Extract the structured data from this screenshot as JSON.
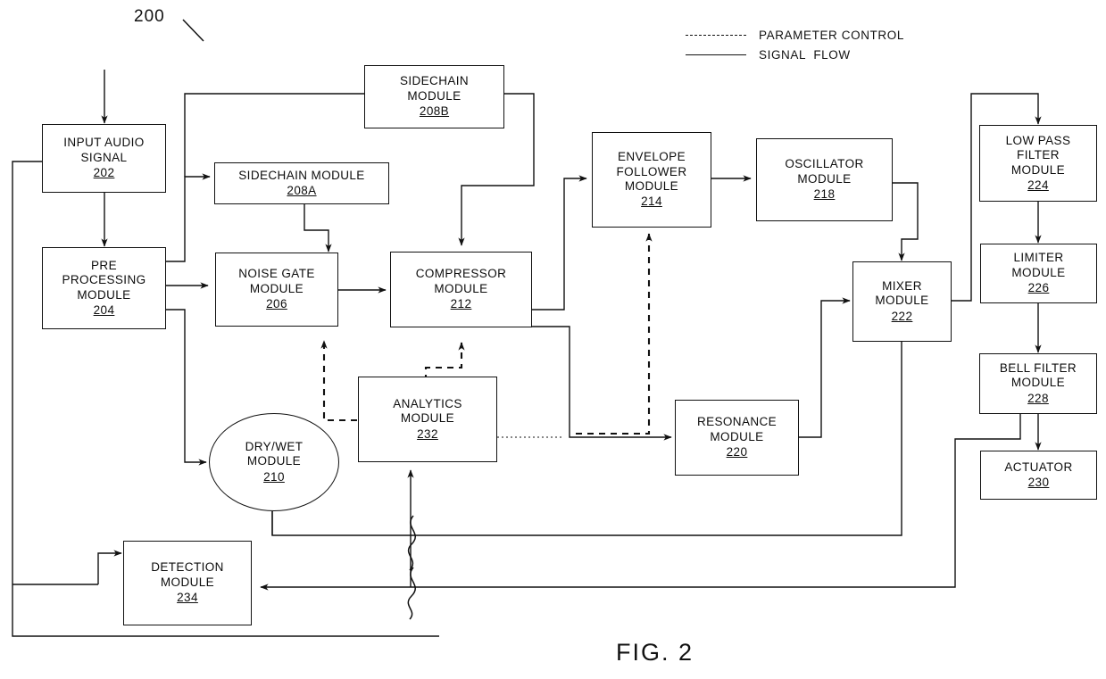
{
  "figure": {
    "caption": "FIG. 2",
    "reference_tag": "200"
  },
  "legend": {
    "items": [
      {
        "style": "dashed",
        "label": "PARAMETER CONTROL"
      },
      {
        "style": "solid",
        "label": "SIGNAL  FLOW"
      }
    ]
  },
  "nodes": {
    "input_audio_signal": {
      "label": "INPUT AUDIO\nSIGNAL",
      "ref": "202"
    },
    "pre_processing": {
      "label": "PRE\nPROCESSING\nMODULE",
      "ref": "204"
    },
    "sidechain_b": {
      "label": "SIDECHAIN\nMODULE",
      "ref": "208B"
    },
    "sidechain_a": {
      "label": "SIDECHAIN MODULE",
      "ref": "208A"
    },
    "noise_gate": {
      "label": "NOISE GATE\nMODULE",
      "ref": "206"
    },
    "compressor": {
      "label": "COMPRESSOR\nMODULE",
      "ref": "212"
    },
    "envelope_follower": {
      "label": "ENVELOPE\nFOLLOWER\nMODULE",
      "ref": "214"
    },
    "oscillator": {
      "label": "OSCILLATOR\nMODULE",
      "ref": "218"
    },
    "low_pass_filter": {
      "label": "LOW PASS\nFILTER\nMODULE",
      "ref": "224"
    },
    "limiter": {
      "label": "LIMITER\nMODULE",
      "ref": "226"
    },
    "bell_filter": {
      "label": "BELL FILTER\nMODULE",
      "ref": "228"
    },
    "actuator": {
      "label": "ACTUATOR",
      "ref": "230"
    },
    "mixer": {
      "label": "MIXER\nMODULE",
      "ref": "222"
    },
    "resonance": {
      "label": "RESONANCE\nMODULE",
      "ref": "220"
    },
    "dry_wet": {
      "label": "DRY/WET\nMODULE",
      "ref": "210"
    },
    "analytics": {
      "label": "ANALYTICS\nMODULE",
      "ref": "232"
    },
    "detection": {
      "label": "DETECTION\nMODULE",
      "ref": "234"
    }
  },
  "colors": {
    "ink": "#111111",
    "paper": "#ffffff"
  }
}
